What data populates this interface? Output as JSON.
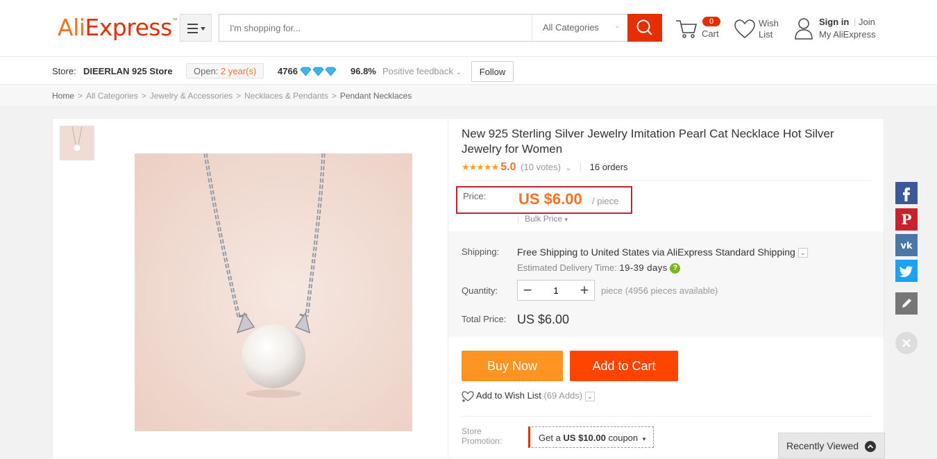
{
  "header": {
    "logo_part1": "Ali",
    "logo_part2": "Express",
    "logo_tm": "™",
    "search_placeholder": "I'm shopping for...",
    "category_select": "All Categories",
    "cart_count": "0",
    "cart_label": "Cart",
    "wish_line1": "Wish",
    "wish_line2": "List",
    "sign_in": "Sign in",
    "join": "Join",
    "my_account": "My AliExpress",
    "icons": [
      "menu-icon",
      "search-icon",
      "cart-icon",
      "heart-icon",
      "user-icon"
    ]
  },
  "store": {
    "label": "Store:",
    "name": "DIEERLAN 925 Store",
    "open_label": "Open:",
    "open_value": "2 year(s)",
    "score": "4766",
    "positive_value": "96.8%",
    "positive_label": "Positive feedback",
    "follow": "Follow"
  },
  "breadcrumb": [
    "Home",
    "All Categories",
    "Jewelry & Accessories",
    "Necklaces & Pendants",
    "Pendant Necklaces"
  ],
  "product": {
    "title": "New 925 Sterling Silver Jewelry Imitation Pearl Cat Necklace Hot Silver Jewelry for Women",
    "rating_stars": 5,
    "rating": "5.0",
    "votes": "(10 votes)",
    "orders": "16 orders",
    "price_label": "Price:",
    "price": "US $6.00",
    "price_unit": "/ piece",
    "bulk_price": "Bulk Price",
    "shipping_label": "Shipping:",
    "shipping_bold": "Free Shipping",
    "shipping_to": "to",
    "shipping_rest": "United States via AliExpress Standard Shipping",
    "delivery_label": "Estimated Delivery Time:",
    "delivery_value": "19-39 days",
    "quantity_label": "Quantity:",
    "quantity": "1",
    "available": "piece (4956 pieces available)",
    "total_label": "Total Price:",
    "total": "US $6.00",
    "buy_now": "Buy Now",
    "add_to_cart": "Add to Cart",
    "wishlist": "Add to Wish List",
    "wishlist_count": "(69 Adds)",
    "promo_label_1": "Store",
    "promo_label_2": "Promotion:",
    "coupon_prefix": "Get a",
    "coupon_value": "US $10.00",
    "coupon_suffix": "coupon"
  },
  "social": {
    "colors": {
      "facebook": "#3b5998",
      "pinterest": "#c8232c",
      "vk": "#4a76a8",
      "twitter": "#1da1f2",
      "edit": "#777777"
    }
  },
  "recently_viewed": "Recently Viewed",
  "colors": {
    "accent_orange": "#f57224",
    "accent_red": "#e62e04",
    "buy": "#ff9423",
    "cart": "#ff4400"
  }
}
